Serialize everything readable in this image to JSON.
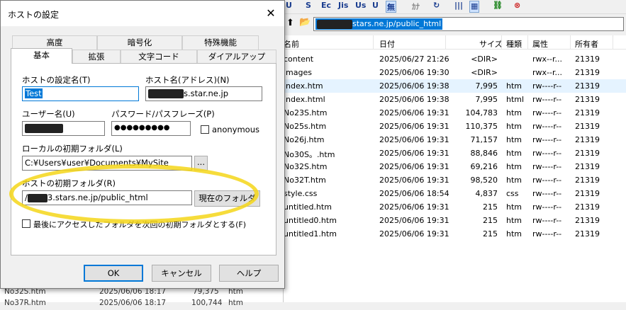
{
  "background_app": {
    "path_bar": {
      "path_suffix": "stars.ne.jp/public_html"
    },
    "toolbar": {
      "items": [
        "U",
        "S",
        "Ec",
        "Jis",
        "Us",
        "U",
        "無",
        "ｶﾅ",
        "↻",
        "|||",
        "▦",
        "⛓",
        "⊗"
      ]
    },
    "file_list": {
      "columns": [
        "名前",
        "日付",
        "サイズ",
        "種類",
        "属性",
        "所有者"
      ],
      "rows": [
        {
          "name": "content",
          "date": "2025/06/27 21:26",
          "size": "<DIR>",
          "type": "",
          "attr": "rwx--r...",
          "owner": "21319"
        },
        {
          "name": "images",
          "date": "2025/06/06 19:30",
          "size": "<DIR>",
          "type": "",
          "attr": "rwx--r...",
          "owner": "21319"
        },
        {
          "name": "index.htm",
          "date": "2025/06/06 19:38",
          "size": "7,995",
          "type": "htm",
          "attr": "rw----r--",
          "owner": "21319"
        },
        {
          "name": "index.html",
          "date": "2025/06/06 19:38",
          "size": "7,995",
          "type": "html",
          "attr": "rw----r--",
          "owner": "21319"
        },
        {
          "name": "No23S.htm",
          "date": "2025/06/06 19:31",
          "size": "104,783",
          "type": "htm",
          "attr": "rw----r--",
          "owner": "21319"
        },
        {
          "name": "No25s.htm",
          "date": "2025/06/06 19:31",
          "size": "110,375",
          "type": "htm",
          "attr": "rw----r--",
          "owner": "21319"
        },
        {
          "name": "No26j.htm",
          "date": "2025/06/06 19:31",
          "size": "71,157",
          "type": "htm",
          "attr": "rw----r--",
          "owner": "21319"
        },
        {
          "name": "No30S。.htm",
          "date": "2025/06/06 19:31",
          "size": "88,846",
          "type": "htm",
          "attr": "rw----r--",
          "owner": "21319"
        },
        {
          "name": "No32S.htm",
          "date": "2025/06/06 19:31",
          "size": "69,216",
          "type": "htm",
          "attr": "rw----r--",
          "owner": "21319"
        },
        {
          "name": "No32T.htm",
          "date": "2025/06/06 19:31",
          "size": "98,520",
          "type": "htm",
          "attr": "rw----r--",
          "owner": "21319"
        },
        {
          "name": "style.css",
          "date": "2025/06/06 18:54",
          "size": "4,837",
          "type": "css",
          "attr": "rw----r--",
          "owner": "21319"
        },
        {
          "name": "untitled.htm",
          "date": "2025/06/06 19:31",
          "size": "215",
          "type": "htm",
          "attr": "rw----r--",
          "owner": "21319"
        },
        {
          "name": "untitled0.htm",
          "date": "2025/06/06 19:31",
          "size": "215",
          "type": "htm",
          "attr": "rw----r--",
          "owner": "21319"
        },
        {
          "name": "untitled1.htm",
          "date": "2025/06/06 19:31",
          "size": "215",
          "type": "htm",
          "attr": "rw----r--",
          "owner": "21319"
        }
      ]
    },
    "left_pane_rows": [
      {
        "name": "No32S.htm",
        "date": "2025/06/06 18:17",
        "size": "79,375",
        "type": "htm"
      },
      {
        "name": "No37R.htm",
        "date": "2025/06/06 18:17",
        "size": "100,744",
        "type": "htm"
      }
    ]
  },
  "dialog": {
    "title": "ホストの設定",
    "close_glyph": "✕",
    "tabs_back": [
      "高度",
      "暗号化",
      "特殊機能"
    ],
    "tabs_front": [
      "基本",
      "拡張",
      "文字コード",
      "ダイアルアップ"
    ],
    "host_setting_name": {
      "label": "ホストの設定名(T)",
      "value": "Test"
    },
    "host_name": {
      "label": "ホスト名(アドレス)(N)",
      "value_suffix": "s.star.ne.jp"
    },
    "username": {
      "label": "ユーザー名(U)"
    },
    "password": {
      "label": "パスワード/パスフレーズ(P)",
      "value": "●●●●●●●●●"
    },
    "anonymous": {
      "label": "anonymous",
      "checked": false
    },
    "local_folder": {
      "label": "ローカルの初期フォルダ(L)",
      "value": "C:¥Users¥user¥Documents¥MySite",
      "browse_label": "..."
    },
    "host_folder": {
      "label": "ホストの初期フォルダ(R)",
      "value_prefix": "/",
      "value_suffix": "3.stars.ne.jp/public_html",
      "current_folder_button": "現在のフォルダ"
    },
    "remember_last": {
      "label": "最後にアクセスしたフォルダを次回の初期フォルダとする(F)",
      "checked": false
    },
    "buttons": {
      "ok": "OK",
      "cancel": "キャンセル",
      "help": "ヘルプ"
    },
    "highlight_color": "#f5d619"
  }
}
